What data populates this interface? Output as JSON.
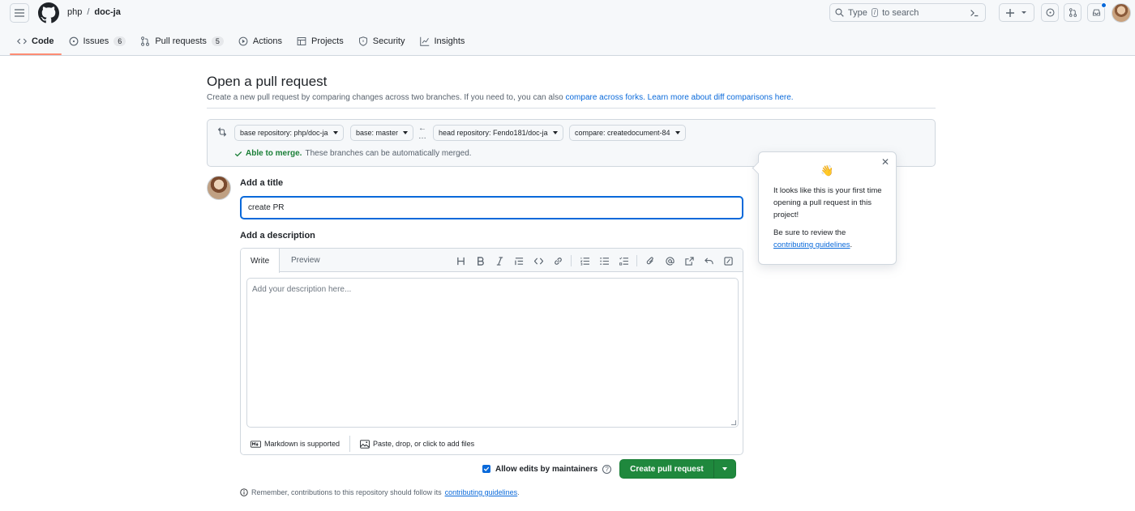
{
  "header": {
    "owner": "php",
    "separator": "/",
    "repo": "doc-ja",
    "search_prefix": "Type",
    "search_key": "/",
    "search_suffix": "to search"
  },
  "tabs": [
    {
      "label": "Code",
      "count": null
    },
    {
      "label": "Issues",
      "count": "6"
    },
    {
      "label": "Pull requests",
      "count": "5"
    },
    {
      "label": "Actions",
      "count": null
    },
    {
      "label": "Projects",
      "count": null
    },
    {
      "label": "Security",
      "count": null
    },
    {
      "label": "Insights",
      "count": null
    }
  ],
  "page": {
    "title": "Open a pull request",
    "subtitle": "Create a new pull request by comparing changes across two branches. If you need to, you can also",
    "link_forks": "compare across forks.",
    "link_learn": "Learn more about diff comparisons here."
  },
  "compare": {
    "base_repo": "base repository: php/doc-ja",
    "base": "base: master",
    "head_repo": "head repository: Fendo181/doc-ja",
    "compare": "compare: createdocument-84",
    "merge_ok": "Able to merge.",
    "merge_msg": "These branches can be automatically merged."
  },
  "form": {
    "title_label": "Add a title",
    "title_value": "create PR",
    "desc_label": "Add a description",
    "tab_write": "Write",
    "tab_preview": "Preview",
    "desc_placeholder": "Add your description here...",
    "markdown": "Markdown is supported",
    "attach": "Paste, drop, or click to add files",
    "allow_edits": "Allow edits by maintainers",
    "create_button": "Create pull request",
    "remember_prefix": "Remember, contributions to this repository should follow its",
    "remember_link": "contributing guidelines",
    "remember_suffix": "."
  },
  "popover": {
    "emoji": "👋",
    "text": "It looks like this is your first time opening a pull request in this project!",
    "text2": "Be sure to review the",
    "link": "contributing guidelines",
    "suffix": "."
  },
  "colors": {
    "accent": "#0969da",
    "success": "#1f883d",
    "tab_underline": "#fd8c73"
  }
}
